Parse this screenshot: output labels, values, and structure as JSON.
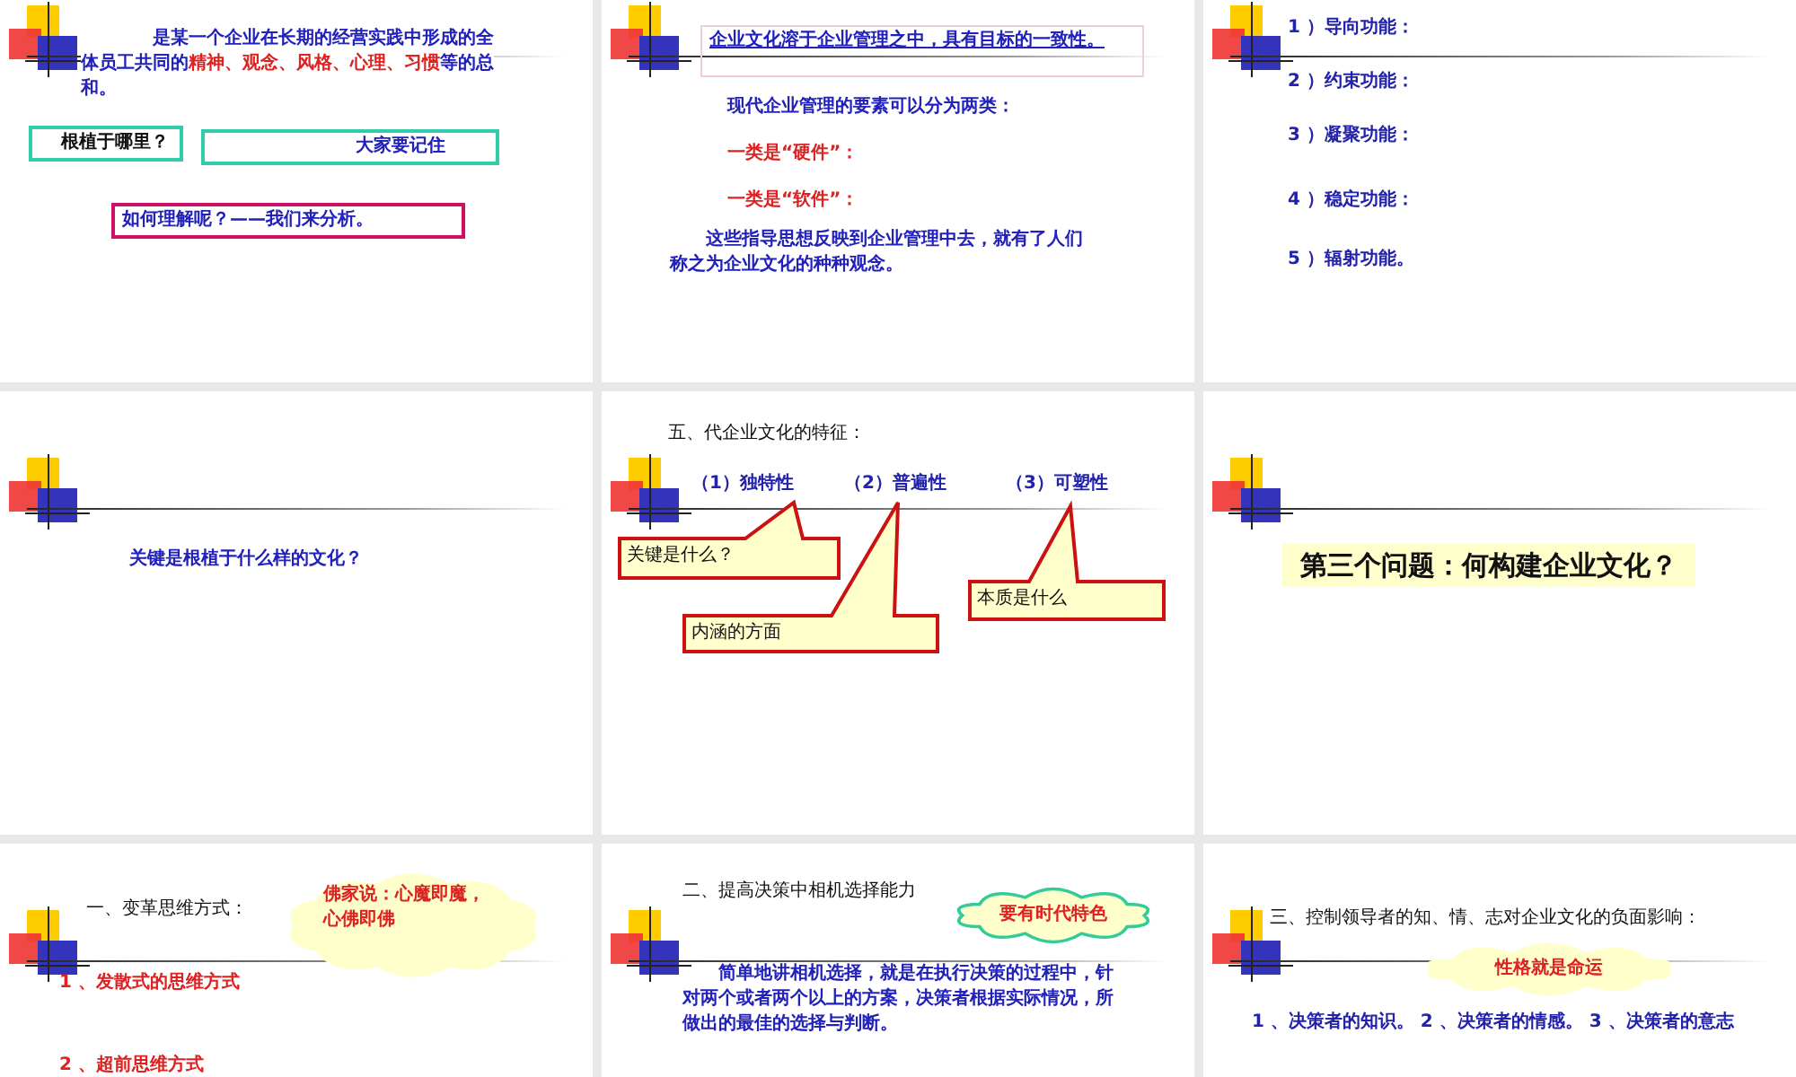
{
  "slides": [
    {
      "items": [
        {
          "kind": "paragraph",
          "segments": [
            {
              "text": "　　　　是某一个企业在长期的经营实践中形成的全体员工共同的",
              "emphasis": false
            },
            {
              "text": "精神、观念、风格、心理、习惯",
              "emphasis": true
            },
            {
              "text": "等的总和。",
              "emphasis": false
            }
          ]
        },
        {
          "kind": "framed_heading",
          "text": "根植于哪里？",
          "color": "#33ccaa"
        },
        {
          "kind": "framed",
          "text": "大家要记住",
          "color": "#33ccaa"
        },
        {
          "kind": "framed",
          "text": "如何理解呢？——我们来分析。",
          "color": "#cc1166"
        }
      ]
    },
    {
      "items": [
        {
          "kind": "framed",
          "text": "企业文化溶于企业管理之中，具有目标的一致性。",
          "color": "#f0d0d8",
          "underlined": true
        },
        {
          "kind": "body",
          "text": "现代企业管理的要素可以分为两类："
        },
        {
          "kind": "accent",
          "text": "一类是“硬件”："
        },
        {
          "kind": "accent",
          "text": "一类是“软件”："
        },
        {
          "kind": "body",
          "text": "　　这些指导思想反映到企业管理中去，就有了人们称之为企业文化的种种观念。"
        }
      ]
    },
    {
      "items": [
        {
          "kind": "point",
          "text": "1 ）导向功能："
        },
        {
          "kind": "point",
          "text": "2 ）约束功能："
        },
        {
          "kind": "point",
          "text": "3 ）凝聚功能："
        },
        {
          "kind": "point",
          "text": "4 ）稳定功能："
        },
        {
          "kind": "point",
          "text": "5 ）辐射功能。"
        }
      ]
    },
    {
      "items": [
        {
          "kind": "body",
          "text": "关键是根植于什么样的文化？"
        }
      ]
    },
    {
      "items": [
        {
          "kind": "heading",
          "text": "五、代企业文化的特征："
        },
        {
          "kind": "point",
          "text": "（1）独特性"
        },
        {
          "kind": "point",
          "text": "（2）普遍性"
        },
        {
          "kind": "point",
          "text": "（3）可塑性"
        },
        {
          "kind": "callout",
          "text": "关键是什么？"
        },
        {
          "kind": "callout",
          "text": "内涵的方面"
        },
        {
          "kind": "callout",
          "text": "本质是什么"
        }
      ]
    },
    {
      "items": [
        {
          "kind": "highlight",
          "text": "第三个问题：何构建企业文化？"
        }
      ]
    },
    {
      "items": [
        {
          "kind": "heading",
          "text": "一、变革思维方式："
        },
        {
          "kind": "cloud",
          "text": "佛家说：心魔即魔，心佛即佛",
          "outlined": false
        },
        {
          "kind": "accent_point",
          "text": "1 、发散式的思维方式"
        },
        {
          "kind": "accent_point",
          "text": "2 、超前思维方式"
        }
      ]
    },
    {
      "items": [
        {
          "kind": "heading",
          "text": "二、提高决策中相机选择能力"
        },
        {
          "kind": "cloud",
          "text": "要有时代特色",
          "outlined": true
        },
        {
          "kind": "body",
          "text": "　　简单地讲相机选择，就是在执行决策的过程中，针对两个或者两个以上的方案，决策者根据实际情况，所做出的最佳的选择与判断。"
        }
      ]
    },
    {
      "items": [
        {
          "kind": "heading",
          "text": "三、控制领导者的知、情、志对企业文化的负面影响："
        },
        {
          "kind": "cloud",
          "text": "性格就是命运",
          "outlined": false
        },
        {
          "kind": "point",
          "text": "1 、决策者的知识。 2 、决策者的情感。  3 、决策者的意志"
        }
      ]
    }
  ]
}
